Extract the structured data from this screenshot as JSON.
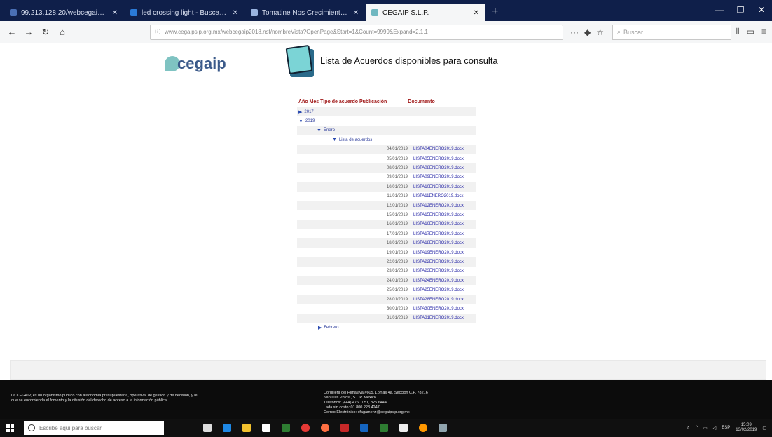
{
  "browser": {
    "tabs": [
      {
        "title": "99.213.128.20/webcegaip.e...",
        "active": false
      },
      {
        "title": "led crossing light - Buscar con...",
        "active": false
      },
      {
        "title": "Tomatine Nos Crecimiento Lo...",
        "active": false
      },
      {
        "title": "CEGAIP S.L.P.",
        "active": true
      }
    ],
    "new_tab": "+",
    "url": "www.cegaipslp.org.mx/webcegaip2018.nsf/nombreVista?OpenPage&Start=1&Count=9999&Expand=2.1.1",
    "search_placeholder": "Buscar"
  },
  "page": {
    "logo_text": "cegaip",
    "title": "Lista de Acuerdos disponibles para consulta",
    "table_headers": {
      "col1": "Año Mes Tipo de acuerdo Publicación",
      "col2": "Documento"
    },
    "years": {
      "y2017": "2017",
      "y2019": "2019"
    },
    "month_open": "Enero",
    "list_type": "Lista de acuerdos",
    "month_closed": "Febrero",
    "documents": [
      {
        "date": "04/01/2019",
        "file": "LISTA04ENERO2019.docx"
      },
      {
        "date": "05/01/2019",
        "file": "LISTA05ENERO2019.docx"
      },
      {
        "date": "08/01/2019",
        "file": "LISTA08ENERO2019.docx"
      },
      {
        "date": "09/01/2019",
        "file": "LISTA09ENERO2019.docx"
      },
      {
        "date": "10/01/2019",
        "file": "LISTA10ENERO2019.docx"
      },
      {
        "date": "11/01/2019",
        "file": "LISTA11ENERO2019.docx"
      },
      {
        "date": "12/01/2019",
        "file": "LISTA12ENERO2019.docx"
      },
      {
        "date": "15/01/2019",
        "file": "LISTA15ENERO2019.docx"
      },
      {
        "date": "16/01/2019",
        "file": "LISTA16ENERO2019.docx"
      },
      {
        "date": "17/01/2019",
        "file": "LISTA17ENERO2019.docx"
      },
      {
        "date": "18/01/2019",
        "file": "LISTA18ENERO2019.docx"
      },
      {
        "date": "19/01/2019",
        "file": "LISTA19ENERO2019.docx"
      },
      {
        "date": "22/01/2019",
        "file": "LISTA22ENERO2019.docx"
      },
      {
        "date": "23/01/2019",
        "file": "LISTA23ENERO2019.docx"
      },
      {
        "date": "24/01/2019",
        "file": "LISTA24ENERO2019.docx"
      },
      {
        "date": "25/01/2019",
        "file": "LISTA25ENERO2019.docx"
      },
      {
        "date": "28/01/2019",
        "file": "LISTA28ENERO2019.docx"
      },
      {
        "date": "30/01/2019",
        "file": "LISTA30ENERO2019.docx"
      },
      {
        "date": "31/01/2019",
        "file": "LISTA31ENERO2019.docx"
      }
    ]
  },
  "footer": {
    "left": "La CEGAIP, es un organismo público con autonomía presupuestaria, operativa, de gestión y de decisión, y le que se encomienda el fomento y la difusión del derecho de acceso a la información pública.",
    "right1": "Cordillera del Himalaya #605, Lomas 4a. Sección C.P. 78216",
    "right2": "San Luis Potosí, S.L.P. México",
    "right3": "Teléfonos: (444) 476 1051, 825 6444",
    "right4": "Lada sin costo: 01 800 223 4247",
    "right5": "Correo Electrónico: cfagamenz@cegaipslp.org.mx"
  },
  "taskbar": {
    "search_placeholder": "Escribe aquí para buscar",
    "time": "15:09",
    "date": "13/02/2019",
    "lang": "ESP"
  },
  "colors": {
    "header_red": "#a01818",
    "link_blue": "#2a2aa8",
    "tabbar": "#0f1f4a"
  }
}
